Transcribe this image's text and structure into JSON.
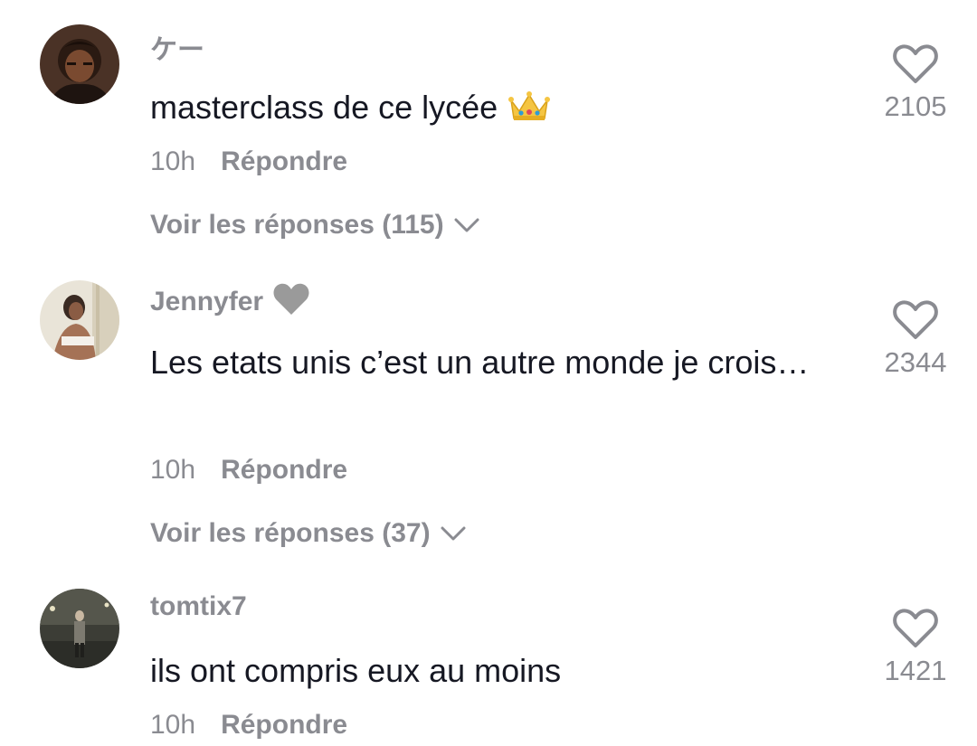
{
  "comments": [
    {
      "username": "ケー",
      "username_emoji": "",
      "text": "masterclass de ce lycée",
      "text_emoji": "crown",
      "time": "10h",
      "reply_label": "Répondre",
      "view_replies_label": "Voir les réponses (115)",
      "likes": "2105"
    },
    {
      "username": "Jennyfer",
      "username_emoji": "grey-heart",
      "text": "Les etats unis c’est un autre monde je crois…",
      "text_emoji": "",
      "time": "10h",
      "reply_label": "Répondre",
      "view_replies_label": "Voir les réponses (37)",
      "likes": "2344"
    },
    {
      "username": "tomtix7",
      "username_emoji": "",
      "text": "ils ont compris eux au moins",
      "text_emoji": "",
      "time": "10h",
      "reply_label": "Répondre",
      "view_replies_label": "",
      "likes": "1421"
    }
  ],
  "colors": {
    "text_primary": "#161823",
    "text_secondary": "#8a8b91",
    "background": "#ffffff"
  },
  "icons": {
    "like": "heart-outline-icon",
    "expand": "chevron-down-icon"
  }
}
